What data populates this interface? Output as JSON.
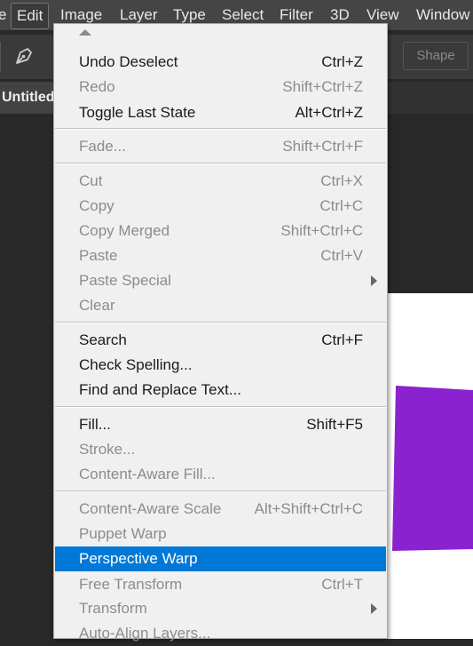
{
  "menubar": {
    "items": [
      "e",
      "Edit",
      "Image",
      "Layer",
      "Type",
      "Select",
      "Filter",
      "3D",
      "View",
      "Window"
    ],
    "active": "Edit"
  },
  "toolbar": {
    "tool_icon": "pen-icon",
    "shape_label": "Shape"
  },
  "document": {
    "tab_title": "Untitled"
  },
  "canvas": {
    "shape_color": "#8b22cf"
  },
  "edit_menu": {
    "items": [
      {
        "label": "Undo Deselect",
        "shortcut": "Ctrl+Z",
        "enabled": true
      },
      {
        "label": "Redo",
        "shortcut": "Shift+Ctrl+Z",
        "enabled": false
      },
      {
        "label": "Toggle Last State",
        "shortcut": "Alt+Ctrl+Z",
        "enabled": true
      },
      {
        "label": "Fade...",
        "shortcut": "Shift+Ctrl+F",
        "enabled": false
      },
      {
        "label": "Cut",
        "shortcut": "Ctrl+X",
        "enabled": false
      },
      {
        "label": "Copy",
        "shortcut": "Ctrl+C",
        "enabled": false
      },
      {
        "label": "Copy Merged",
        "shortcut": "Shift+Ctrl+C",
        "enabled": false
      },
      {
        "label": "Paste",
        "shortcut": "Ctrl+V",
        "enabled": false
      },
      {
        "label": "Paste Special",
        "shortcut": "",
        "enabled": false,
        "submenu": true
      },
      {
        "label": "Clear",
        "shortcut": "",
        "enabled": false
      },
      {
        "label": "Search",
        "shortcut": "Ctrl+F",
        "enabled": true
      },
      {
        "label": "Check Spelling...",
        "shortcut": "",
        "enabled": true
      },
      {
        "label": "Find and Replace Text...",
        "shortcut": "",
        "enabled": true
      },
      {
        "label": "Fill...",
        "shortcut": "Shift+F5",
        "enabled": true
      },
      {
        "label": "Stroke...",
        "shortcut": "",
        "enabled": false
      },
      {
        "label": "Content-Aware Fill...",
        "shortcut": "",
        "enabled": false
      },
      {
        "label": "Content-Aware Scale",
        "shortcut": "Alt+Shift+Ctrl+C",
        "enabled": false
      },
      {
        "label": "Puppet Warp",
        "shortcut": "",
        "enabled": false
      },
      {
        "label": "Perspective Warp",
        "shortcut": "",
        "enabled": true,
        "highlighted": true
      },
      {
        "label": "Free Transform",
        "shortcut": "Ctrl+T",
        "enabled": false
      },
      {
        "label": "Transform",
        "shortcut": "",
        "enabled": false,
        "submenu": true
      },
      {
        "label": "Auto-Align Layers...",
        "shortcut": "",
        "enabled": false
      }
    ],
    "highlight_color": "#0078d7"
  }
}
